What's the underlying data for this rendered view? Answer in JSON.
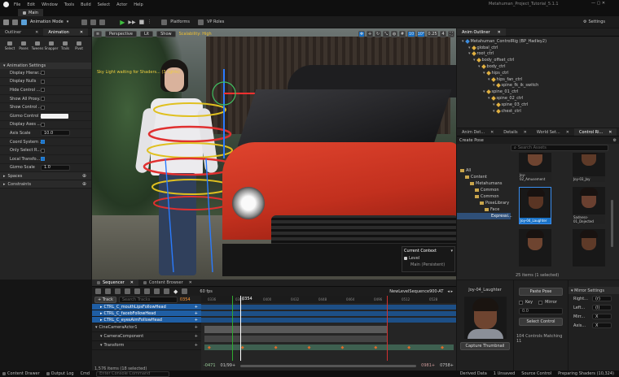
{
  "title_bar": {
    "menus": [
      "File",
      "Edit",
      "Window",
      "Tools",
      "Build",
      "Select",
      "Actor",
      "Help"
    ],
    "project": "Metahuman_Project_Tutorial_5.1.1",
    "level_tab": "Main"
  },
  "toolbar": {
    "mode": "Animation Mode",
    "platforms": "Platforms",
    "vp": "VP Roles",
    "settings": "Settings"
  },
  "outliner_tabs": [
    "Outliner",
    "Animation"
  ],
  "anim_tools": [
    "Select",
    "Poses",
    "Tweens",
    "Snapper",
    "Trails",
    "Pivot"
  ],
  "anim_settings": {
    "header": "Animation Settings",
    "rows": [
      {
        "label": "Display Hierar...",
        "type": "check",
        "on": false
      },
      {
        "label": "Display Nulls",
        "type": "check",
        "on": false
      },
      {
        "label": "Hide Control ...",
        "type": "check",
        "on": false
      },
      {
        "label": "Show All Proxy...",
        "type": "check",
        "on": false
      },
      {
        "label": "Show Control ...",
        "type": "check",
        "on": false
      },
      {
        "label": "Gizmo Control ...",
        "type": "color",
        "on": false
      },
      {
        "label": "Display Axes ...",
        "type": "check",
        "on": false
      },
      {
        "label": "Axis Scale",
        "type": "num",
        "value": "10.0"
      },
      {
        "label": "Coord System ...",
        "type": "check",
        "on": true
      },
      {
        "label": "Only Select R...",
        "type": "check",
        "on": false
      },
      {
        "label": "Local Transfo...",
        "type": "check",
        "on": true
      },
      {
        "label": "Gizmo Scale",
        "type": "num",
        "value": "1.0"
      }
    ],
    "sections": [
      "Spaces",
      "Constraints"
    ]
  },
  "viewport": {
    "perspective": "Perspective",
    "lit": "Lit",
    "show": "Show",
    "scalability": "Scalability: High",
    "overlay": "Sky Light waiting for Shaders... (3 lights)",
    "control_context": "Current Context",
    "level_label": "Level",
    "level_value": "Main (Persistent)"
  },
  "rig_outliner": {
    "tab": "Anim Outliner",
    "items": [
      "Metahuman_ControlRig (BP_Hadley2)",
      "global_ctrl",
      "root_ctrl",
      "body_offset_ctrl",
      "body_ctrl",
      "hips_ctrl",
      "hips_fan_ctrl",
      "spine_fk_ik_switch",
      "spine_01_ctrl",
      "spine_02_ctrl",
      "spine_03_ctrl",
      "chest_ctrl"
    ]
  },
  "right_tabs": [
    "Anim Det...",
    "Details",
    "World Set...",
    "Control Ri..."
  ],
  "pose": {
    "create": "Create Pose",
    "search_ph": "Search Assets",
    "tree": [
      "All",
      "Content",
      "Metahumans",
      "Common",
      "Common",
      "PoseLibrary",
      "Face",
      "Expressi..."
    ],
    "thumbs": [
      {
        "label": "Joy-02_Amusement"
      },
      {
        "label": "Joy-03_Joy"
      },
      {
        "label": "Joy-04_Laughter"
      },
      {
        "label": "Sadness-01_Dejected"
      },
      {
        "label": ""
      },
      {
        "label": ""
      }
    ],
    "count": "25 items (1 selected)"
  },
  "selected_pose": {
    "name": "Joy-04_Laughter",
    "capture": "Capture Thumbnail"
  },
  "paste": {
    "title": "Paste Pose",
    "key": "Key",
    "mirror": "Mirror",
    "select": "Select Control",
    "matching": "104 Controls Matching 11"
  },
  "mirror": {
    "title": "Mirror Settings",
    "rows": [
      {
        "label": "Right...",
        "value": "(r)"
      },
      {
        "label": "Left...",
        "value": "(l)"
      },
      {
        "label": "Mirr...",
        "value": "X"
      },
      {
        "label": "Axis...",
        "value": "X"
      }
    ]
  },
  "seq_tabs": [
    "Sequencer",
    "Content Browser"
  ],
  "sequencer": {
    "fps": "60 fps",
    "sequence": "NewLevelSequence900-AT",
    "track_btn": "+ Track",
    "search_ph": "Search Tracks",
    "frame": "0354",
    "count_badge": "0354",
    "tracks": [
      {
        "label": "CTRL_C_mouthLipsFollowHead",
        "sel": true
      },
      {
        "label": "CTRL_C_facebFollowHead",
        "sel": true
      },
      {
        "label": "CTRL_C_eyesAimFollowHead",
        "sel": true
      },
      {
        "label": "CineCameraActor1",
        "sel": false
      },
      {
        "label": "CameraComponent",
        "sel": false
      },
      {
        "label": "Transform",
        "sel": false
      }
    ],
    "ruler": [
      "0336",
      "0384",
      "0400",
      "0432",
      "0448",
      "0464",
      "0496",
      "0512",
      "0528"
    ],
    "status": "1,576 items (18 selected)",
    "start": "-0471",
    "cur": "01/99+",
    "end": "0981+",
    "end2": "0758+"
  },
  "status_bar": {
    "drawer": "Content Drawer",
    "output": "Output Log",
    "cmd": "Cmd",
    "cmd_ph": "Enter Console Command",
    "derived": "Derived Data",
    "unsaved": "1 Unsaved",
    "source": "Source Control",
    "shaders": "Preparing Shaders (10,324)"
  }
}
